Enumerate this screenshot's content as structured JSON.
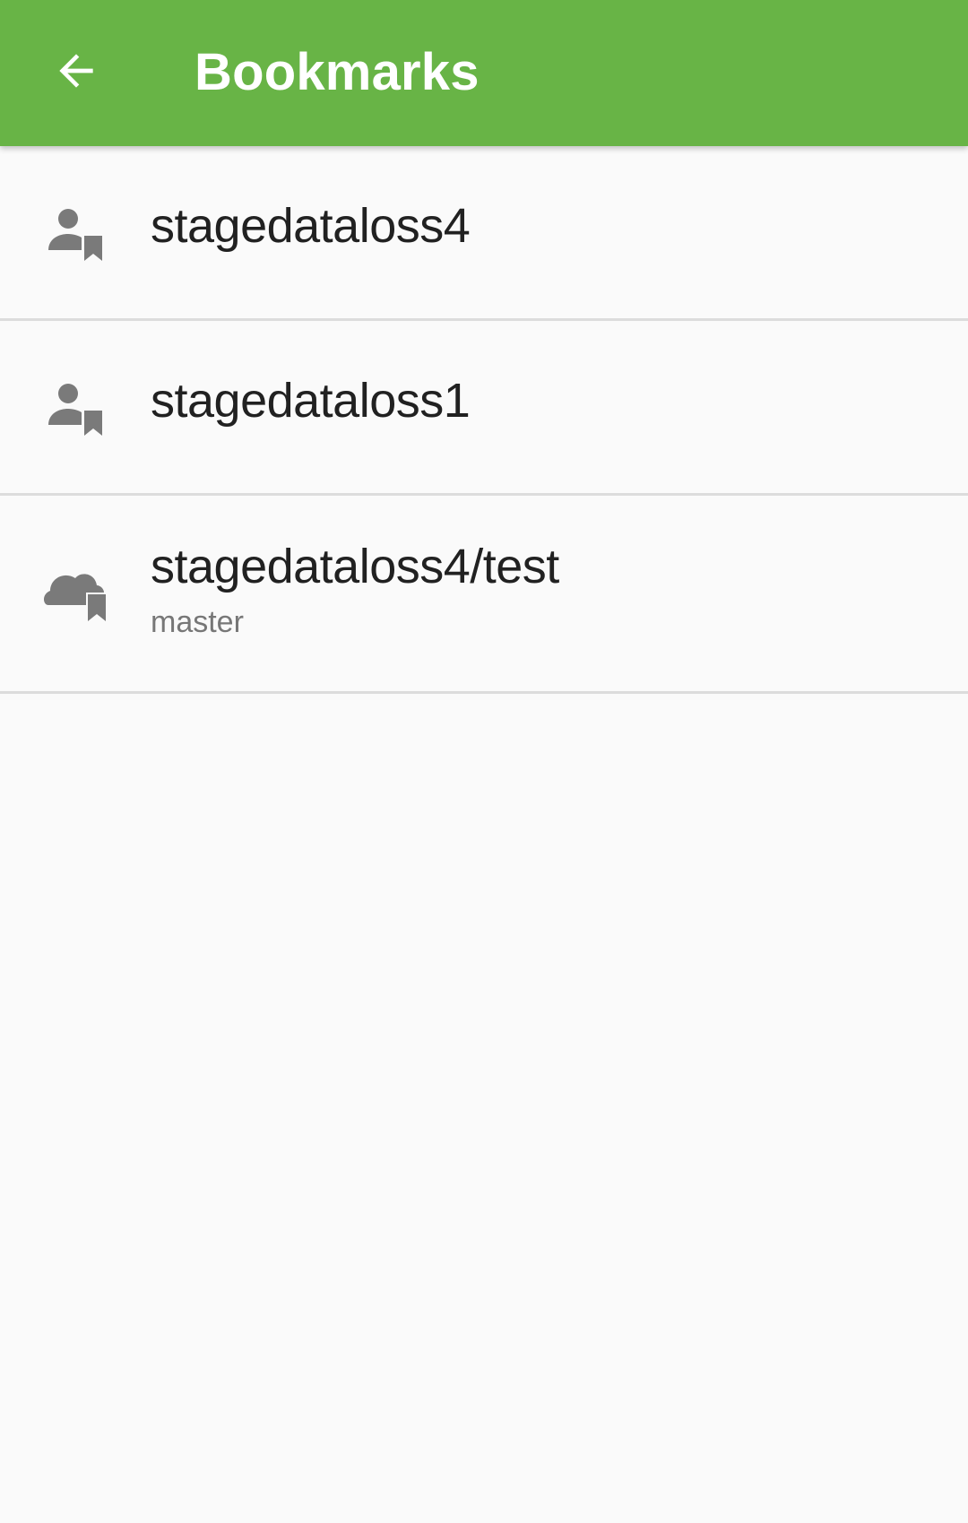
{
  "app_bar": {
    "title": "Bookmarks",
    "background_color": "#68b446",
    "back_icon": "arrow-back-icon"
  },
  "bookmarks": [
    {
      "type": "user",
      "icon": "user-bookmark-icon",
      "title": "stagedataloss4"
    },
    {
      "type": "user",
      "icon": "user-bookmark-icon",
      "title": "stagedataloss1"
    },
    {
      "type": "repository",
      "icon": "cloud-bookmark-icon",
      "title": "stagedataloss4/test",
      "subtitle": "master"
    }
  ]
}
